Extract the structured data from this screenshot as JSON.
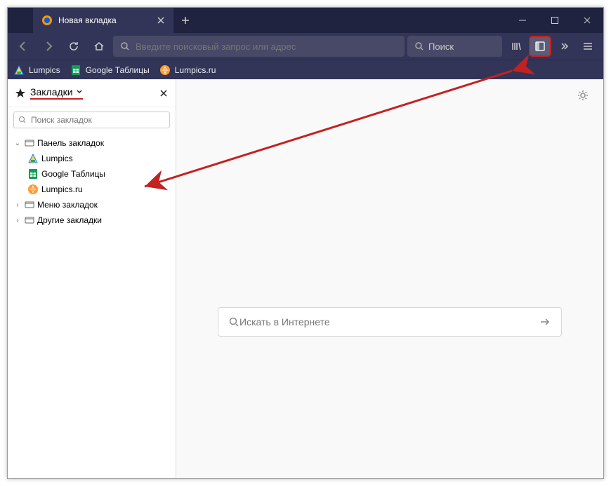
{
  "tab": {
    "title": "Новая вкладка"
  },
  "urlbar": {
    "placeholder": "Введите поисковый запрос или адрес"
  },
  "searchbox": {
    "placeholder": "Поиск"
  },
  "bookmarks_toolbar": [
    {
      "label": "Lumpics",
      "icon": "lumpics"
    },
    {
      "label": "Google Таблицы",
      "icon": "sheets"
    },
    {
      "label": "Lumpics.ru",
      "icon": "lumpicsru"
    }
  ],
  "sidebar": {
    "title": "Закладки",
    "search_placeholder": "Поиск закладок",
    "tree": {
      "toolbar_folder": "Панель закладок",
      "items": [
        {
          "label": "Lumpics",
          "icon": "lumpics"
        },
        {
          "label": "Google Таблицы",
          "icon": "sheets"
        },
        {
          "label": "Lumpics.ru",
          "icon": "lumpicsru"
        }
      ],
      "menu_folder": "Меню закладок",
      "other_folder": "Другие закладки"
    }
  },
  "newtab": {
    "search_placeholder": "Искать в Интернете"
  }
}
